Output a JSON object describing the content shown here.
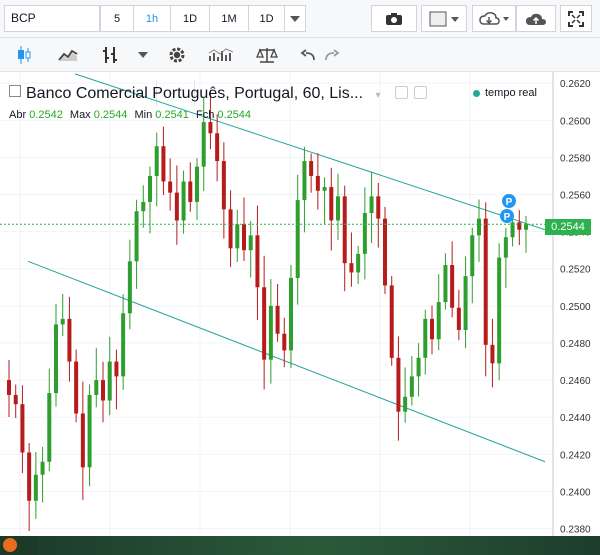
{
  "symbol": "BCP",
  "intervals": [
    {
      "label": "5",
      "active": false
    },
    {
      "label": "1h",
      "active": true
    },
    {
      "label": "1D",
      "active": false
    },
    {
      "label": "1M",
      "active": false
    },
    {
      "label": "1D",
      "active": false
    }
  ],
  "legend": {
    "title": "Banco Comercial Português, Portugal, 60, Lis...",
    "abr_label": "Abr",
    "abr": "0.2542",
    "max_label": "Max",
    "max": "0.2544",
    "min_label": "Min",
    "min": "0.2541",
    "fch_label": "Fch",
    "fch": "0.2544"
  },
  "status": "tempo real",
  "last_price": "0.2544",
  "colors": {
    "up": "#2e9e2e",
    "down": "#b71c1c",
    "accent": "#2196f3",
    "trendline": "#26a69a",
    "last_price": "#2bb24c"
  },
  "markers": [
    "P",
    "P"
  ],
  "chart_data": {
    "type": "candlestick",
    "y_ticks": [
      "0.2620",
      "0.2600",
      "0.2580",
      "0.2560",
      "0.2540",
      "0.2520",
      "0.2500",
      "0.2480",
      "0.2460",
      "0.2440",
      "0.2420",
      "0.2400",
      "0.2380"
    ],
    "ylim": [
      0.2376,
      0.2626
    ],
    "last_price": 0.2544,
    "closes": [
      0.2452,
      0.2447,
      0.2421,
      0.2395,
      0.2409,
      0.2416,
      0.2453,
      0.249,
      0.2493,
      0.247,
      0.2442,
      0.2413,
      0.2452,
      0.246,
      0.2449,
      0.247,
      0.2462,
      0.2496,
      0.2524,
      0.2551,
      0.2556,
      0.257,
      0.2586,
      0.2567,
      0.2561,
      0.2546,
      0.2567,
      0.2556,
      0.2575,
      0.2599,
      0.2593,
      0.2578,
      0.2552,
      0.2531,
      0.2544,
      0.253,
      0.2538,
      0.251,
      0.2471,
      0.25,
      0.2485,
      0.2476,
      0.2515,
      0.2557,
      0.2578,
      0.257,
      0.2562,
      0.2564,
      0.2546,
      0.2559,
      0.2523,
      0.2518,
      0.2528,
      0.255,
      0.2559,
      0.2547,
      0.2511,
      0.2472,
      0.2443,
      0.2451,
      0.2462,
      0.2472,
      0.2493,
      0.2482,
      0.2502,
      0.2522,
      0.2499,
      0.2487,
      0.2516,
      0.2538,
      0.2547,
      0.2479,
      0.2469,
      0.2526,
      0.2537,
      0.2545,
      0.2541,
      0.2544
    ],
    "channel_upper": [
      [
        0.2625,
        0.2541
      ]
    ],
    "channel_lower": [
      [
        0.2524,
        0.2416
      ]
    ]
  }
}
